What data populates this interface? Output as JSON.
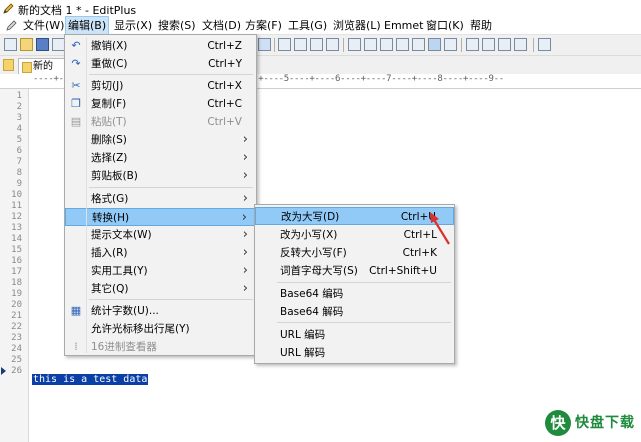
{
  "window": {
    "title": "新的文档 1 * - EditPlus"
  },
  "menubar": [
    "文件(W)",
    "编辑(B)",
    "显示(X)",
    "搜索(S)",
    "文档(D)",
    "方案(F)",
    "工具(G)",
    "浏览器(L)",
    "Emmet",
    "窗口(K)",
    "帮助"
  ],
  "doc_tab": {
    "label": "新的"
  },
  "ruler": "----+----1----+----2----+----3----+----4----+----5----+----6----+----7----+----8----+----9--",
  "gutter": [
    "1",
    "2",
    "3",
    "4",
    "5",
    "6",
    "7",
    "8",
    "9",
    "10",
    "11",
    "12",
    "13",
    "14",
    "15",
    "16",
    "17",
    "18",
    "19",
    "20",
    "21",
    "22",
    "23",
    "24",
    "25",
    "26"
  ],
  "editor": {
    "selected_text": "this is a test data"
  },
  "edit_menu": {
    "items": [
      {
        "label": "撤销(X)",
        "shortcut": "Ctrl+Z",
        "icon": "undo-icon"
      },
      {
        "label": "重做(C)",
        "shortcut": "Ctrl+Y",
        "icon": "redo-icon"
      },
      {
        "label": "剪切(J)",
        "shortcut": "Ctrl+X",
        "icon": "cut-icon"
      },
      {
        "label": "复制(F)",
        "shortcut": "Ctrl+C",
        "icon": "copy-icon"
      },
      {
        "label": "粘贴(T)",
        "shortcut": "Ctrl+V",
        "icon": "paste-icon",
        "disabled": true
      },
      {
        "label": "删除(S)",
        "submenu": true
      },
      {
        "label": "选择(Z)",
        "submenu": true
      },
      {
        "label": "剪贴板(B)",
        "submenu": true
      },
      {
        "label": "格式(G)",
        "submenu": true
      },
      {
        "label": "转换(H)",
        "submenu": true,
        "highlighted": true
      },
      {
        "label": "提示文本(W)",
        "submenu": true
      },
      {
        "label": "插入(R)",
        "submenu": true
      },
      {
        "label": "实用工具(Y)",
        "submenu": true
      },
      {
        "label": "其它(Q)",
        "submenu": true
      },
      {
        "label": "统计字数(U)...",
        "icon": "word-count-icon"
      },
      {
        "label": "允许光标移出行尾(Y)"
      },
      {
        "label": "16进制查看器",
        "icon": "hex-icon",
        "disabled": true
      }
    ]
  },
  "convert_menu": {
    "items": [
      {
        "label": "改为大写(D)",
        "shortcut": "Ctrl+U",
        "highlighted": true
      },
      {
        "label": "改为小写(X)",
        "shortcut": "Ctrl+L"
      },
      {
        "label": "反转大小写(F)",
        "shortcut": "Ctrl+K"
      },
      {
        "label": "词首字母大写(S)",
        "shortcut": "Ctrl+Shift+U"
      },
      {
        "label": "Base64 编码"
      },
      {
        "label": "Base64 解码"
      },
      {
        "label": "URL 编码"
      },
      {
        "label": "URL 解码"
      }
    ]
  },
  "watermark": {
    "brand": "快盘下载",
    "glyph": "快"
  },
  "colors": {
    "highlight": "#91c9f7",
    "selection": "#0a3fa6",
    "arrow": "#d9322c"
  }
}
